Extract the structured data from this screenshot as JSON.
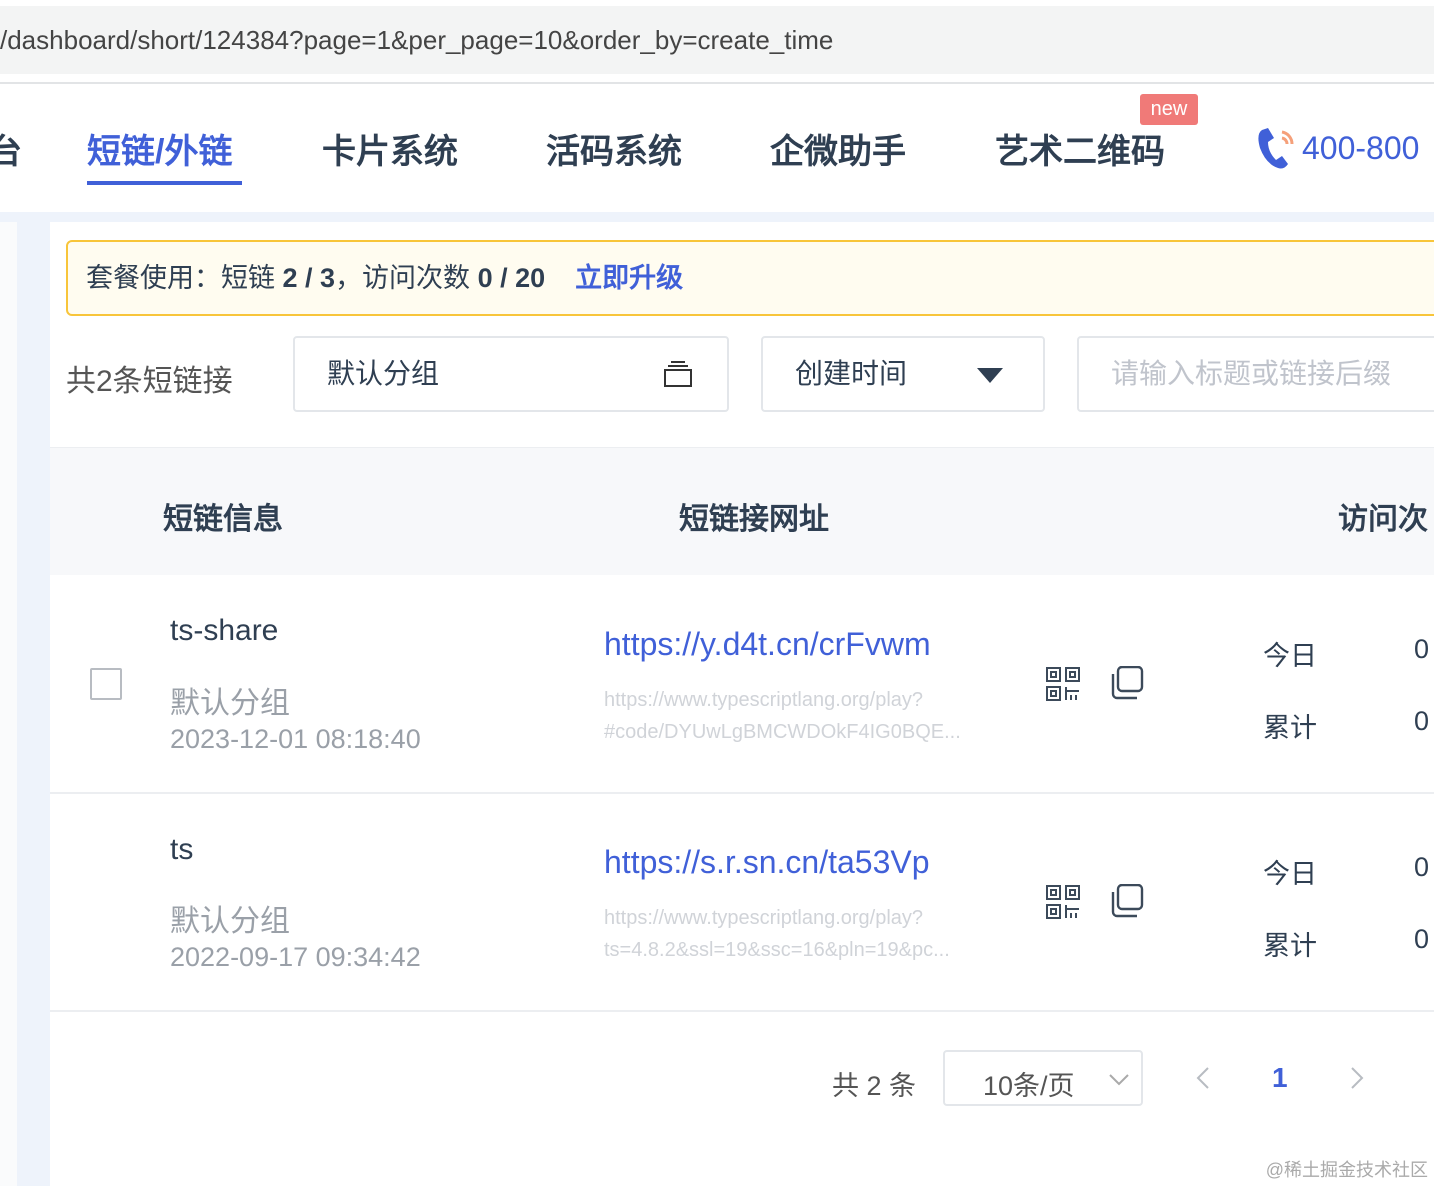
{
  "browser": {
    "url": "/dashboard/short/124384?page=1&per_page=10&order_by=create_time"
  },
  "nav": {
    "tabs": [
      {
        "label": "短链/外链",
        "active": true
      },
      {
        "label": "卡片系统"
      },
      {
        "label": "活码系统"
      },
      {
        "label": "企微助手"
      },
      {
        "label": "艺术二维码",
        "badge": "new"
      }
    ],
    "phone": "400-800",
    "partial_left": "台"
  },
  "alert": {
    "prefix": "套餐使用：短链",
    "short_used": "2 / 3",
    "sep": "，访问次数",
    "visits_used": "0 / 20",
    "upgrade": "立即升级"
  },
  "filters": {
    "count": "共2条短链接",
    "group": "默认分组",
    "sort": "创建时间",
    "search_placeholder": "请输入标题或链接后缀"
  },
  "table": {
    "headers": [
      "短链信息",
      "短链接网址",
      "访问次"
    ],
    "rows": [
      {
        "title": "ts-share",
        "group": "默认分组",
        "date": "2023-12-01 08:18:40",
        "short": "https://y.d4t.cn/crFvwm",
        "orig1": "https://www.typescriptlang.org/play?",
        "orig2": "#code/DYUwLgBMCWDOkF4IG0BQE...",
        "today_label": "今日",
        "today": "0",
        "total_label": "累计",
        "total": "0"
      },
      {
        "title": "ts",
        "group": "默认分组",
        "date": "2022-09-17 09:34:42",
        "short": "https://s.r.sn.cn/ta53Vp",
        "orig1": "https://www.typescriptlang.org/play?",
        "orig2": "ts=4.8.2&ssl=19&ssc=16&pln=19&pc...",
        "today_label": "今日",
        "today": "0",
        "total_label": "累计",
        "total": "0"
      }
    ]
  },
  "pagination": {
    "total": "共 2 条",
    "per_page": "10条/页",
    "current": "1"
  },
  "watermark": "@稀土掘金技术社区",
  "colors": {
    "accent": "#4060d8",
    "badge": "#f07a78",
    "alert_border": "#f8c53a"
  }
}
